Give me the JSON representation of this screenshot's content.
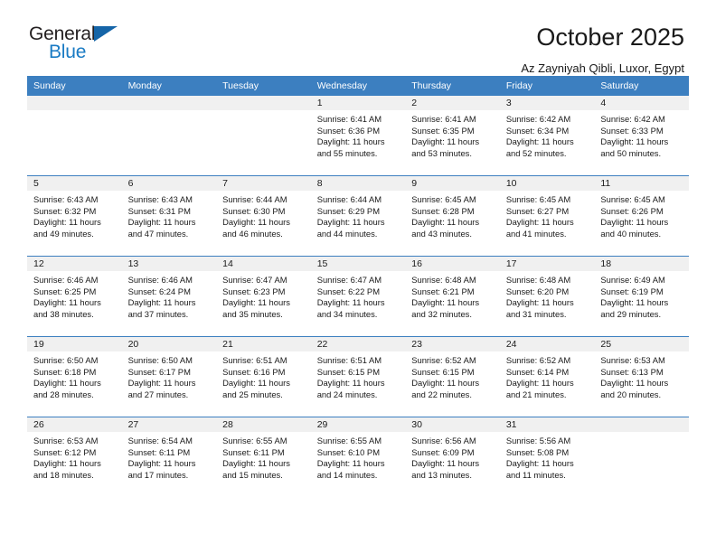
{
  "brand": {
    "name_top": "General",
    "name_bottom": "Blue",
    "accent_color": "#1a7bc4",
    "triangle_color": "#1565a8"
  },
  "header": {
    "title": "October 2025",
    "subtitle": "Az Zayniyah Qibli, Luxor, Egypt"
  },
  "calendar": {
    "header_bg": "#3c7fc0",
    "daynum_bg": "#f0f0f0",
    "weekday_headers": [
      "Sunday",
      "Monday",
      "Tuesday",
      "Wednesday",
      "Thursday",
      "Friday",
      "Saturday"
    ],
    "weeks": [
      [
        {
          "day": "",
          "lines": []
        },
        {
          "day": "",
          "lines": []
        },
        {
          "day": "",
          "lines": []
        },
        {
          "day": "1",
          "lines": [
            "Sunrise: 6:41 AM",
            "Sunset: 6:36 PM",
            "Daylight: 11 hours",
            "and 55 minutes."
          ]
        },
        {
          "day": "2",
          "lines": [
            "Sunrise: 6:41 AM",
            "Sunset: 6:35 PM",
            "Daylight: 11 hours",
            "and 53 minutes."
          ]
        },
        {
          "day": "3",
          "lines": [
            "Sunrise: 6:42 AM",
            "Sunset: 6:34 PM",
            "Daylight: 11 hours",
            "and 52 minutes."
          ]
        },
        {
          "day": "4",
          "lines": [
            "Sunrise: 6:42 AM",
            "Sunset: 6:33 PM",
            "Daylight: 11 hours",
            "and 50 minutes."
          ]
        }
      ],
      [
        {
          "day": "5",
          "lines": [
            "Sunrise: 6:43 AM",
            "Sunset: 6:32 PM",
            "Daylight: 11 hours",
            "and 49 minutes."
          ]
        },
        {
          "day": "6",
          "lines": [
            "Sunrise: 6:43 AM",
            "Sunset: 6:31 PM",
            "Daylight: 11 hours",
            "and 47 minutes."
          ]
        },
        {
          "day": "7",
          "lines": [
            "Sunrise: 6:44 AM",
            "Sunset: 6:30 PM",
            "Daylight: 11 hours",
            "and 46 minutes."
          ]
        },
        {
          "day": "8",
          "lines": [
            "Sunrise: 6:44 AM",
            "Sunset: 6:29 PM",
            "Daylight: 11 hours",
            "and 44 minutes."
          ]
        },
        {
          "day": "9",
          "lines": [
            "Sunrise: 6:45 AM",
            "Sunset: 6:28 PM",
            "Daylight: 11 hours",
            "and 43 minutes."
          ]
        },
        {
          "day": "10",
          "lines": [
            "Sunrise: 6:45 AM",
            "Sunset: 6:27 PM",
            "Daylight: 11 hours",
            "and 41 minutes."
          ]
        },
        {
          "day": "11",
          "lines": [
            "Sunrise: 6:45 AM",
            "Sunset: 6:26 PM",
            "Daylight: 11 hours",
            "and 40 minutes."
          ]
        }
      ],
      [
        {
          "day": "12",
          "lines": [
            "Sunrise: 6:46 AM",
            "Sunset: 6:25 PM",
            "Daylight: 11 hours",
            "and 38 minutes."
          ]
        },
        {
          "day": "13",
          "lines": [
            "Sunrise: 6:46 AM",
            "Sunset: 6:24 PM",
            "Daylight: 11 hours",
            "and 37 minutes."
          ]
        },
        {
          "day": "14",
          "lines": [
            "Sunrise: 6:47 AM",
            "Sunset: 6:23 PM",
            "Daylight: 11 hours",
            "and 35 minutes."
          ]
        },
        {
          "day": "15",
          "lines": [
            "Sunrise: 6:47 AM",
            "Sunset: 6:22 PM",
            "Daylight: 11 hours",
            "and 34 minutes."
          ]
        },
        {
          "day": "16",
          "lines": [
            "Sunrise: 6:48 AM",
            "Sunset: 6:21 PM",
            "Daylight: 11 hours",
            "and 32 minutes."
          ]
        },
        {
          "day": "17",
          "lines": [
            "Sunrise: 6:48 AM",
            "Sunset: 6:20 PM",
            "Daylight: 11 hours",
            "and 31 minutes."
          ]
        },
        {
          "day": "18",
          "lines": [
            "Sunrise: 6:49 AM",
            "Sunset: 6:19 PM",
            "Daylight: 11 hours",
            "and 29 minutes."
          ]
        }
      ],
      [
        {
          "day": "19",
          "lines": [
            "Sunrise: 6:50 AM",
            "Sunset: 6:18 PM",
            "Daylight: 11 hours",
            "and 28 minutes."
          ]
        },
        {
          "day": "20",
          "lines": [
            "Sunrise: 6:50 AM",
            "Sunset: 6:17 PM",
            "Daylight: 11 hours",
            "and 27 minutes."
          ]
        },
        {
          "day": "21",
          "lines": [
            "Sunrise: 6:51 AM",
            "Sunset: 6:16 PM",
            "Daylight: 11 hours",
            "and 25 minutes."
          ]
        },
        {
          "day": "22",
          "lines": [
            "Sunrise: 6:51 AM",
            "Sunset: 6:15 PM",
            "Daylight: 11 hours",
            "and 24 minutes."
          ]
        },
        {
          "day": "23",
          "lines": [
            "Sunrise: 6:52 AM",
            "Sunset: 6:15 PM",
            "Daylight: 11 hours",
            "and 22 minutes."
          ]
        },
        {
          "day": "24",
          "lines": [
            "Sunrise: 6:52 AM",
            "Sunset: 6:14 PM",
            "Daylight: 11 hours",
            "and 21 minutes."
          ]
        },
        {
          "day": "25",
          "lines": [
            "Sunrise: 6:53 AM",
            "Sunset: 6:13 PM",
            "Daylight: 11 hours",
            "and 20 minutes."
          ]
        }
      ],
      [
        {
          "day": "26",
          "lines": [
            "Sunrise: 6:53 AM",
            "Sunset: 6:12 PM",
            "Daylight: 11 hours",
            "and 18 minutes."
          ]
        },
        {
          "day": "27",
          "lines": [
            "Sunrise: 6:54 AM",
            "Sunset: 6:11 PM",
            "Daylight: 11 hours",
            "and 17 minutes."
          ]
        },
        {
          "day": "28",
          "lines": [
            "Sunrise: 6:55 AM",
            "Sunset: 6:11 PM",
            "Daylight: 11 hours",
            "and 15 minutes."
          ]
        },
        {
          "day": "29",
          "lines": [
            "Sunrise: 6:55 AM",
            "Sunset: 6:10 PM",
            "Daylight: 11 hours",
            "and 14 minutes."
          ]
        },
        {
          "day": "30",
          "lines": [
            "Sunrise: 6:56 AM",
            "Sunset: 6:09 PM",
            "Daylight: 11 hours",
            "and 13 minutes."
          ]
        },
        {
          "day": "31",
          "lines": [
            "Sunrise: 5:56 AM",
            "Sunset: 5:08 PM",
            "Daylight: 11 hours",
            "and 11 minutes."
          ]
        },
        {
          "day": "",
          "lines": []
        }
      ]
    ]
  }
}
